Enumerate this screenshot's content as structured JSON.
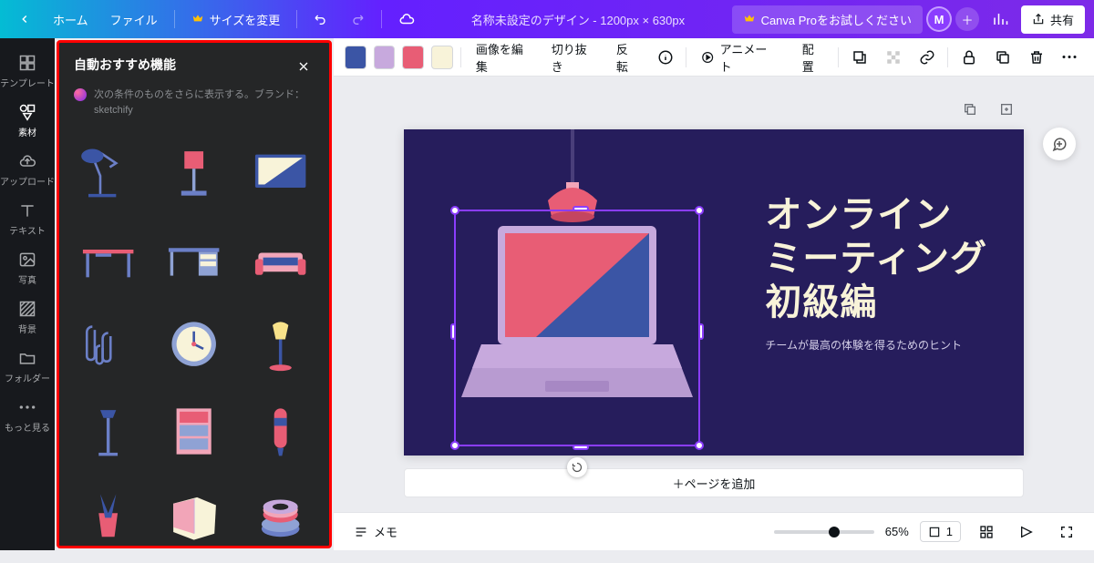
{
  "topbar": {
    "home": "ホーム",
    "file": "ファイル",
    "resize": "サイズを変更",
    "docname": "名称未設定のデザイン - 1200px × 630px",
    "trypro": "Canva Proをお試しください",
    "avatar": "M",
    "share": "共有"
  },
  "rail": {
    "template": "テンプレート",
    "elements": "素材",
    "upload": "アップロード",
    "text": "テキスト",
    "photo": "写真",
    "background": "背景",
    "folder": "フォルダー",
    "more": "もっと見る"
  },
  "panel": {
    "title": "自動おすすめ機能",
    "subtitle": "次の条件のものをさらに表示する。ブランド：sketchify"
  },
  "ctx": {
    "swatches": [
      "#3b55a5",
      "#c7a9dd",
      "#e85d75",
      "#f8f3d9"
    ],
    "editimg": "画像を編集",
    "crop": "切り抜き",
    "flip": "反転",
    "animate": "アニメート",
    "position": "配置"
  },
  "canvas": {
    "title_l1": "オンライン",
    "title_l2": "ミーティング",
    "title_l3": "初級編",
    "subtitle": "チームが最高の体験を得るためのヒント"
  },
  "addpage": "＋ページを追加",
  "bottom": {
    "notes": "メモ",
    "zoom": "65%",
    "pagecount": "1"
  }
}
